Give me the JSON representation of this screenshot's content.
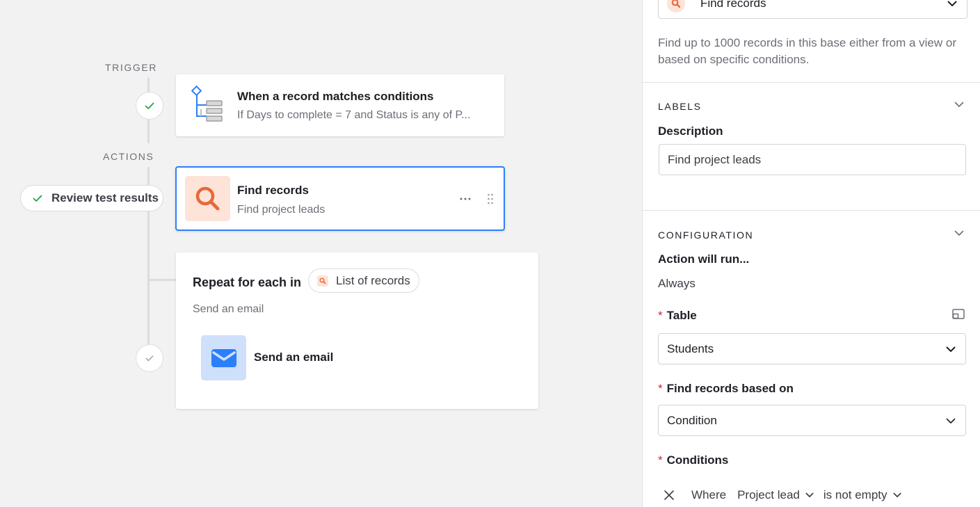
{
  "canvas": {
    "trigger_label": "TRIGGER",
    "actions_label": "ACTIONS",
    "review_button_label": "Review test results",
    "trigger_card": {
      "title": "When a record matches conditions",
      "subtitle": "If Days to complete = 7 and Status is any of P..."
    },
    "find_card": {
      "title": "Find records",
      "subtitle": "Find project leads"
    },
    "repeat_card": {
      "title": "Repeat for each in",
      "chip_label": "List of records",
      "subtitle": "Send an email",
      "inner_action_label": "Send an email"
    }
  },
  "panel": {
    "action_select_value": "Find records",
    "description_text": "Find up to 1000 records in this base either from a view or based on specific conditions.",
    "labels_section": {
      "heading": "LABELS",
      "description_label": "Description",
      "description_value": "Find project leads"
    },
    "config_section": {
      "heading": "CONFIGURATION",
      "run_label": "Action will run...",
      "run_value": "Always",
      "table_label": "Table",
      "table_value": "Students",
      "find_based_label": "Find records based on",
      "find_based_value": "Condition",
      "conditions_label": "Conditions",
      "required_marker": "*",
      "condition_row": {
        "where": "Where",
        "field": "Project lead",
        "operator": "is not empty"
      }
    }
  },
  "colors": {
    "accent_blue": "#2d7ff9",
    "find_icon_bg": "#fde3d8",
    "find_icon_fg": "#e8683a",
    "email_icon_bg": "#cfe0fc",
    "email_icon_fg": "#2d7ff9",
    "check_green": "#20a34a",
    "required_red": "#d0282f"
  },
  "icons": [
    "check-icon",
    "conditions-tree-icon",
    "search-icon",
    "more-dots-icon",
    "drag-handle-icon",
    "mail-icon",
    "chevron-down-icon",
    "expand-icon",
    "close-icon"
  ]
}
